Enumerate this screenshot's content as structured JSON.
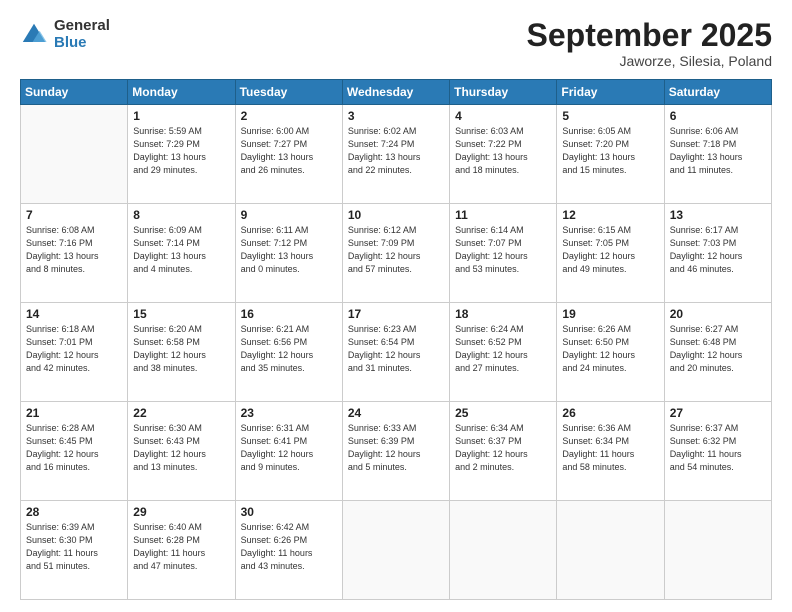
{
  "header": {
    "logo_line1": "General",
    "logo_line2": "Blue",
    "month": "September 2025",
    "location": "Jaworze, Silesia, Poland"
  },
  "weekdays": [
    "Sunday",
    "Monday",
    "Tuesday",
    "Wednesday",
    "Thursday",
    "Friday",
    "Saturday"
  ],
  "weeks": [
    [
      {
        "day": "",
        "info": ""
      },
      {
        "day": "1",
        "info": "Sunrise: 5:59 AM\nSunset: 7:29 PM\nDaylight: 13 hours\nand 29 minutes."
      },
      {
        "day": "2",
        "info": "Sunrise: 6:00 AM\nSunset: 7:27 PM\nDaylight: 13 hours\nand 26 minutes."
      },
      {
        "day": "3",
        "info": "Sunrise: 6:02 AM\nSunset: 7:24 PM\nDaylight: 13 hours\nand 22 minutes."
      },
      {
        "day": "4",
        "info": "Sunrise: 6:03 AM\nSunset: 7:22 PM\nDaylight: 13 hours\nand 18 minutes."
      },
      {
        "day": "5",
        "info": "Sunrise: 6:05 AM\nSunset: 7:20 PM\nDaylight: 13 hours\nand 15 minutes."
      },
      {
        "day": "6",
        "info": "Sunrise: 6:06 AM\nSunset: 7:18 PM\nDaylight: 13 hours\nand 11 minutes."
      }
    ],
    [
      {
        "day": "7",
        "info": "Sunrise: 6:08 AM\nSunset: 7:16 PM\nDaylight: 13 hours\nand 8 minutes."
      },
      {
        "day": "8",
        "info": "Sunrise: 6:09 AM\nSunset: 7:14 PM\nDaylight: 13 hours\nand 4 minutes."
      },
      {
        "day": "9",
        "info": "Sunrise: 6:11 AM\nSunset: 7:12 PM\nDaylight: 13 hours\nand 0 minutes."
      },
      {
        "day": "10",
        "info": "Sunrise: 6:12 AM\nSunset: 7:09 PM\nDaylight: 12 hours\nand 57 minutes."
      },
      {
        "day": "11",
        "info": "Sunrise: 6:14 AM\nSunset: 7:07 PM\nDaylight: 12 hours\nand 53 minutes."
      },
      {
        "day": "12",
        "info": "Sunrise: 6:15 AM\nSunset: 7:05 PM\nDaylight: 12 hours\nand 49 minutes."
      },
      {
        "day": "13",
        "info": "Sunrise: 6:17 AM\nSunset: 7:03 PM\nDaylight: 12 hours\nand 46 minutes."
      }
    ],
    [
      {
        "day": "14",
        "info": "Sunrise: 6:18 AM\nSunset: 7:01 PM\nDaylight: 12 hours\nand 42 minutes."
      },
      {
        "day": "15",
        "info": "Sunrise: 6:20 AM\nSunset: 6:58 PM\nDaylight: 12 hours\nand 38 minutes."
      },
      {
        "day": "16",
        "info": "Sunrise: 6:21 AM\nSunset: 6:56 PM\nDaylight: 12 hours\nand 35 minutes."
      },
      {
        "day": "17",
        "info": "Sunrise: 6:23 AM\nSunset: 6:54 PM\nDaylight: 12 hours\nand 31 minutes."
      },
      {
        "day": "18",
        "info": "Sunrise: 6:24 AM\nSunset: 6:52 PM\nDaylight: 12 hours\nand 27 minutes."
      },
      {
        "day": "19",
        "info": "Sunrise: 6:26 AM\nSunset: 6:50 PM\nDaylight: 12 hours\nand 24 minutes."
      },
      {
        "day": "20",
        "info": "Sunrise: 6:27 AM\nSunset: 6:48 PM\nDaylight: 12 hours\nand 20 minutes."
      }
    ],
    [
      {
        "day": "21",
        "info": "Sunrise: 6:28 AM\nSunset: 6:45 PM\nDaylight: 12 hours\nand 16 minutes."
      },
      {
        "day": "22",
        "info": "Sunrise: 6:30 AM\nSunset: 6:43 PM\nDaylight: 12 hours\nand 13 minutes."
      },
      {
        "day": "23",
        "info": "Sunrise: 6:31 AM\nSunset: 6:41 PM\nDaylight: 12 hours\nand 9 minutes."
      },
      {
        "day": "24",
        "info": "Sunrise: 6:33 AM\nSunset: 6:39 PM\nDaylight: 12 hours\nand 5 minutes."
      },
      {
        "day": "25",
        "info": "Sunrise: 6:34 AM\nSunset: 6:37 PM\nDaylight: 12 hours\nand 2 minutes."
      },
      {
        "day": "26",
        "info": "Sunrise: 6:36 AM\nSunset: 6:34 PM\nDaylight: 11 hours\nand 58 minutes."
      },
      {
        "day": "27",
        "info": "Sunrise: 6:37 AM\nSunset: 6:32 PM\nDaylight: 11 hours\nand 54 minutes."
      }
    ],
    [
      {
        "day": "28",
        "info": "Sunrise: 6:39 AM\nSunset: 6:30 PM\nDaylight: 11 hours\nand 51 minutes."
      },
      {
        "day": "29",
        "info": "Sunrise: 6:40 AM\nSunset: 6:28 PM\nDaylight: 11 hours\nand 47 minutes."
      },
      {
        "day": "30",
        "info": "Sunrise: 6:42 AM\nSunset: 6:26 PM\nDaylight: 11 hours\nand 43 minutes."
      },
      {
        "day": "",
        "info": ""
      },
      {
        "day": "",
        "info": ""
      },
      {
        "day": "",
        "info": ""
      },
      {
        "day": "",
        "info": ""
      }
    ]
  ]
}
